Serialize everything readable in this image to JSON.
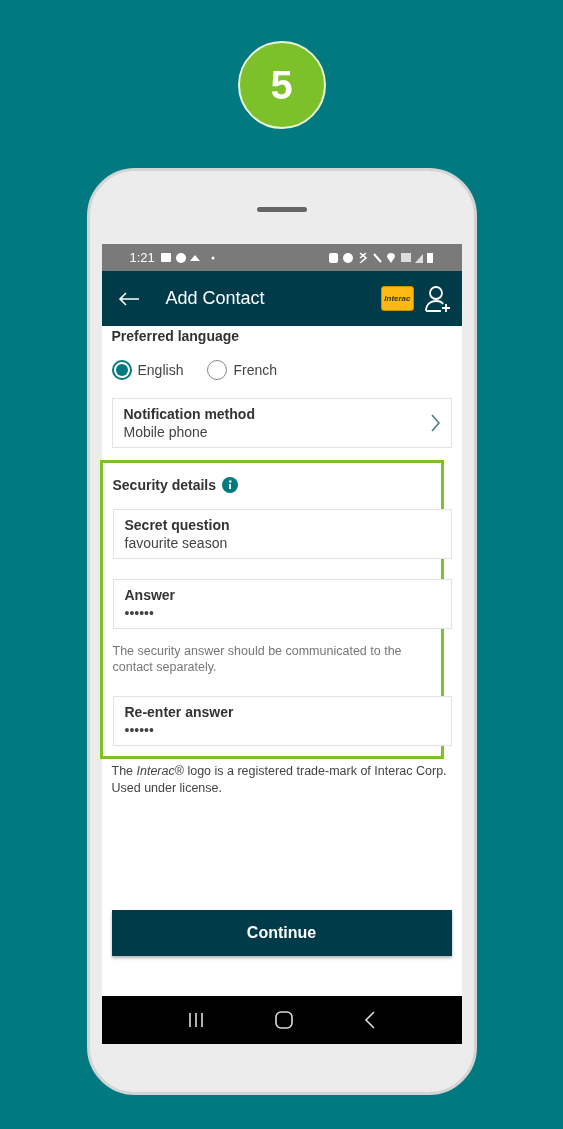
{
  "step": "5",
  "status_bar": {
    "time": "1:21"
  },
  "header": {
    "title": "Add Contact",
    "logo_text": "Interac"
  },
  "preferred_language": {
    "label": "Preferred language",
    "options": [
      {
        "label": "English",
        "selected": true
      },
      {
        "label": "French",
        "selected": false
      }
    ]
  },
  "notification": {
    "label": "Notification method",
    "value": "Mobile phone"
  },
  "security": {
    "title": "Security details",
    "fields": [
      {
        "label": "Secret question",
        "value": "favourite season"
      },
      {
        "label": "Answer",
        "value": "••••••",
        "hint": "The security answer should be communicated to the contact separately."
      },
      {
        "label": "Re-enter answer",
        "value": "••••••"
      }
    ]
  },
  "legal": "The *Interac*® logo is a registered trade-mark of Interac Corp. Used under license.",
  "continue_button": "Continue"
}
